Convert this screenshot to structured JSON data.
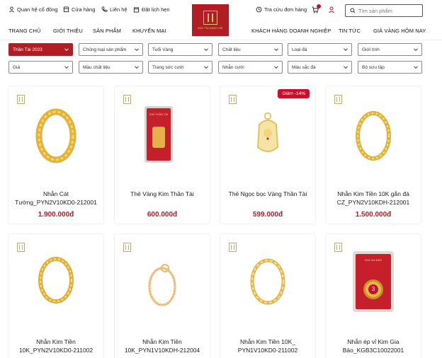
{
  "header": {
    "utilities": [
      {
        "label": "Quan hệ cổ đông",
        "icon": "person-icon"
      },
      {
        "label": "Cửa hàng",
        "icon": "store-icon"
      },
      {
        "label": "Liên hệ",
        "icon": "phone-icon"
      },
      {
        "label": "Đặt lịch hẹn",
        "icon": "calendar-icon"
      }
    ],
    "logo_text": "BẢO TÍN MẠNH HẢI",
    "order_lookup": "Tra cứu đơn hàng",
    "search_placeholder": "Tìm sản phẩm",
    "nav_left": [
      "TRANG CHỦ",
      "GIỚI THIỆU",
      "SẢN PHẨM",
      "KHUYẾN MẠI"
    ],
    "nav_right": [
      "KHÁCH HÀNG DOANH NGHIỆP",
      "TIN TỨC",
      "GIÁ VÀNG HÔM NAY"
    ],
    "accent_color": "#b01e23"
  },
  "filters": {
    "row1": [
      "Thần Tài 2023",
      "Chủng loại sản phẩm",
      "Tuổi Vàng",
      "Chất liệu",
      "Loại đá",
      "Giới tính"
    ],
    "row2": [
      "Giá",
      "Màu chất liệu",
      "Trang sức cưới",
      "Nhẫn cưới",
      "Màu sắc đá",
      "Bộ sưu tập"
    ]
  },
  "products": [
    {
      "name_l1": "Nhẫn Cát",
      "name_l2": "Tường_PYN2V10KD0-212001",
      "price": "1.900.000đ",
      "badge": ""
    },
    {
      "name_l1": "Thẻ Vàng Kim Thần Tài",
      "name_l2": "",
      "price": "600.000đ",
      "badge": ""
    },
    {
      "name_l1": "Thẻ Ngọc bọc Vàng Thần Tài",
      "name_l2": "",
      "price": "599.000đ",
      "badge": "Giảm -14%"
    },
    {
      "name_l1": "Nhẫn Kim Tiền 10K gắn đá",
      "name_l2": "CZ_PYN2V10KDH-212001",
      "price": "1.500.000đ",
      "badge": ""
    },
    {
      "name_l1": "Nhẫn Kim Tiền",
      "name_l2": "10K_PYN2V10KD0-211002",
      "price": "",
      "badge": ""
    },
    {
      "name_l1": "Nhẫn Kim Tiền",
      "name_l2": "10K_PYN1V10KDH-212004",
      "price": "",
      "badge": ""
    },
    {
      "name_l1": "Nhẫn Kim Tiền 10K_",
      "name_l2": "PYN1V10KD0-211002",
      "price": "",
      "badge": ""
    },
    {
      "name_l1": "Nhẫn ép vỉ Kim Gia",
      "name_l2": "Bảo_KGB3C10022001",
      "price": "",
      "badge": ""
    }
  ],
  "card_labels": {
    "gold_card_text": "KIM THẦN TÀI",
    "kim_gia_bao_text": "KIM GIA BẢO",
    "kim_gia_bao_number": "3"
  }
}
